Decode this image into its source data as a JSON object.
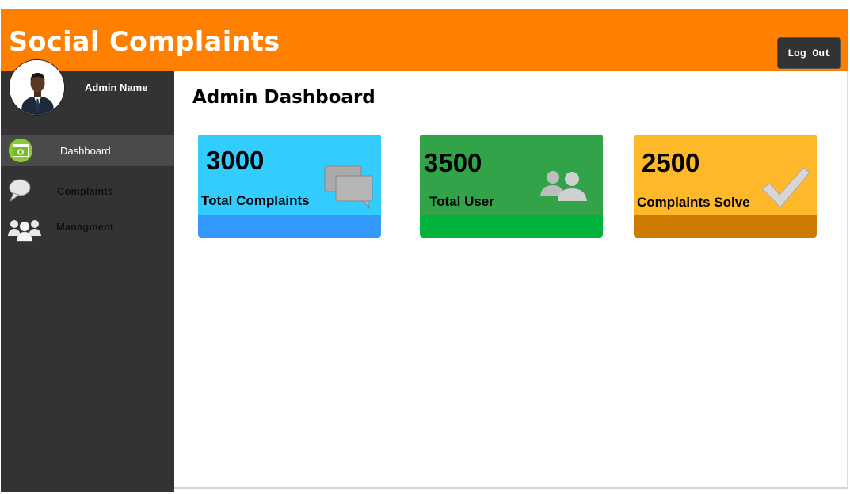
{
  "header": {
    "title": "Social Complaints",
    "logout_label": "Log Out",
    "color": "#ff8000"
  },
  "sidebar": {
    "admin_name": "Admin Name",
    "items": [
      {
        "label": "Dashboard",
        "icon": "dashboard-icon",
        "active": true
      },
      {
        "label": "Complaints",
        "icon": "chat-bubble-icon",
        "active": false
      },
      {
        "label": "Managment",
        "icon": "users-group-icon",
        "active": false
      }
    ]
  },
  "main": {
    "page_title": "Admin Dashboard",
    "cards": [
      {
        "value": "3000",
        "label": "Total Complaints",
        "icon": "comments-icon",
        "color": "#33ccff",
        "footer_color": "#3399ff"
      },
      {
        "value": "3500",
        "label": "Total User",
        "icon": "users-icon",
        "color": "#33a34a",
        "footer_color": "#00b33c"
      },
      {
        "value": "2500",
        "label": "Complaints Solve",
        "icon": "checkmark-icon",
        "color": "#ffb82a",
        "footer_color": "#cc7a00"
      }
    ]
  }
}
